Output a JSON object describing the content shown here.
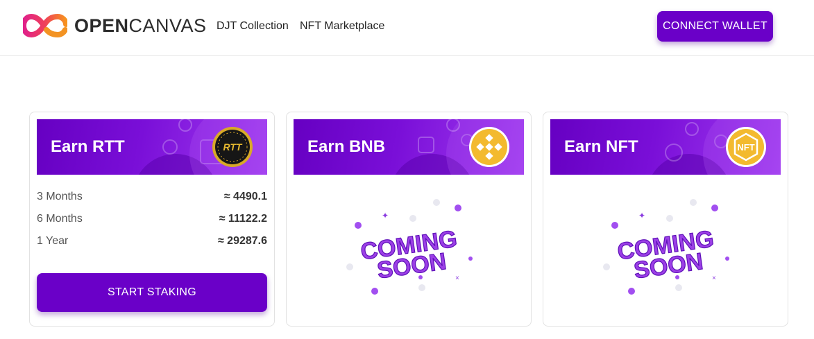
{
  "header": {
    "logo": {
      "bold": "OPEN",
      "light": "CANVAS"
    },
    "nav": [
      "DJT Collection",
      "NFT Marketplace"
    ],
    "connect_label": "CONNECT WALLET"
  },
  "colors": {
    "accent": "#6a00c8",
    "banner_start": "#6600c2",
    "banner_end": "#a13df0"
  },
  "cards": [
    {
      "title": "Earn RTT",
      "coin_icon": "rtt-coin-icon",
      "coin_label": "RTT",
      "rows": [
        {
          "period": "3 Months",
          "amount": "≈ 4490.1"
        },
        {
          "period": "6 Months",
          "amount": "≈ 11122.2"
        },
        {
          "period": "1 Year",
          "amount": "≈ 29287.6"
        }
      ],
      "button_label": "START STAKING"
    },
    {
      "title": "Earn BNB",
      "coin_icon": "bnb-coin-icon",
      "status_line1": "COMING",
      "status_line2": "SOON"
    },
    {
      "title": "Earn NFT",
      "coin_icon": "nft-coin-icon",
      "coin_label": "NFT",
      "status_line1": "COMING",
      "status_line2": "SOON"
    }
  ]
}
